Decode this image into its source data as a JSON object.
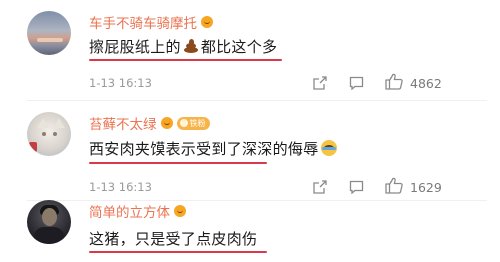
{
  "comments": [
    {
      "username": "车手不骑车骑摩托",
      "text_before": "擦屁股纸上的",
      "emoji_name": "poop-emoji",
      "text_after": "都比这个多",
      "time": "1-13 16:13",
      "likes": "4862",
      "badge": null
    },
    {
      "username": "苔藓不太绿",
      "badge_label": "铁粉",
      "text": "西安肉夹馍表示受到了深深的侮辱",
      "emoji_name": "crying-laughing-emoji",
      "time": "1-13 16:13",
      "likes": "1629"
    },
    {
      "username": "简单的立方体",
      "text": "这猪，只是受了点皮肉伤"
    }
  ],
  "icons": [
    "fan-badge-icon",
    "share-icon",
    "comment-icon",
    "like-icon"
  ],
  "colors": {
    "username": "#eb7350",
    "underline": "#d93a4b",
    "meta": "#9a9a9a",
    "badge": "#f8b44a"
  }
}
